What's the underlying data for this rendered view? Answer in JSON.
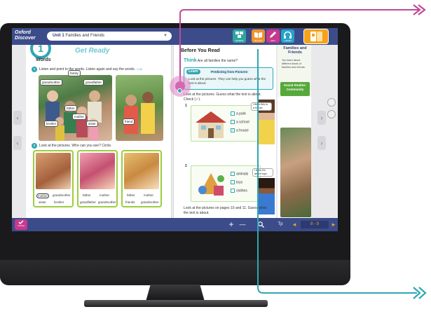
{
  "topbar": {
    "logo_line1": "Oxford",
    "logo_line2": "Discover",
    "unit_prefix": "Unit 1",
    "unit_title": "Families and Friends",
    "tools": [
      "WORDS",
      "BOOKS",
      "PEN",
      "LISTEN"
    ]
  },
  "left_page": {
    "unit_number": "1",
    "banner": "Get Ready",
    "section_title": "Words",
    "instruction_1": "Listen and point to the words. Listen again and say the words.",
    "track_1": "1-02",
    "photo_labels": [
      "family",
      "grandmother",
      "grandfather",
      "father",
      "mother",
      "brother",
      "sister",
      "friend"
    ],
    "instruction_2": "Look at the pictures. Who can you see? Circle.",
    "cards": [
      {
        "words": [
          "mother",
          "grandmother",
          "sister",
          "brother"
        ],
        "circled": [
          "mother"
        ]
      },
      {
        "words": [
          "father",
          "mother",
          "grandfather",
          "grandmother"
        ],
        "circled": []
      },
      {
        "words": [
          "father",
          "mother",
          "friends",
          "grandmother"
        ],
        "circled": []
      }
    ]
  },
  "right_page": {
    "title": "Before You Read",
    "think_label": "Think",
    "think_text": "Are all families the same?",
    "learn_label": "Learn",
    "learn_skill": "Predicting from Pictures",
    "learn_text": "Look at the pictures. They can help you guess what the text is about.",
    "question": "Look at the pictures. Guess what the text is about. Check (✓).",
    "ex1_num": "1",
    "ex1_options": [
      "a park",
      "a school",
      "a house"
    ],
    "ex1_checked": "a house",
    "book1_text": "I think this is a house.",
    "ex2_num": "2",
    "ex2_options": [
      "animals",
      "toys",
      "clothes"
    ],
    "book2_text": "I think it's about toys.",
    "question2": "Look at the pictures on pages 10 and 11. Guess what the text is about."
  },
  "side_panel": {
    "title": "Families and Friends",
    "text": "You learn about different kinds of families and friends.",
    "badge": "Social Studies: Community"
  },
  "bottombar": {
    "finish_label": "FINISH",
    "zoom_in": "+",
    "zoom_out": "—",
    "search_icon": "search-icon",
    "page_label": "8 - 9",
    "goto_label": "Tp"
  },
  "colors": {
    "topbar": "#3c4c8a",
    "teal": "#2fa6b3",
    "magenta": "#c8388e",
    "orange": "#f6a21a",
    "green": "#9ccd3e"
  }
}
